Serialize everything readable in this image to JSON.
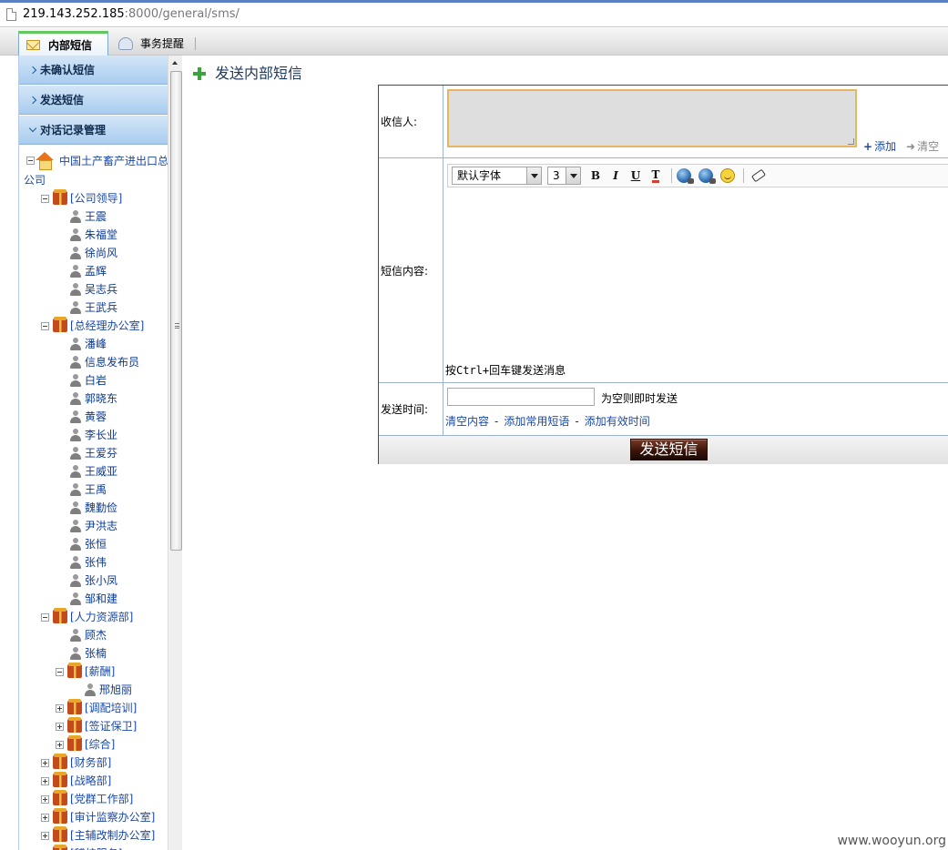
{
  "address_bar": {
    "host": "219.143.252.185",
    "rest": ":8000/general/sms/"
  },
  "tabs": [
    {
      "label": "内部短信",
      "active": true
    },
    {
      "label": "事务提醒",
      "active": false
    }
  ],
  "sidebar": {
    "menu": [
      {
        "label": "未确认短信"
      },
      {
        "label": "发送短信"
      },
      {
        "label": "对话记录管理"
      }
    ],
    "org_root_line1": "中国土产畜产进出口总",
    "org_root_line2": "公司",
    "tree": [
      {
        "type": "dept",
        "label": "[公司领导]",
        "level": 1,
        "expanded": true
      },
      {
        "type": "user",
        "label": "王震",
        "level": 2
      },
      {
        "type": "user",
        "label": "朱福堂",
        "level": 2
      },
      {
        "type": "user",
        "label": "徐尚风",
        "level": 2
      },
      {
        "type": "user",
        "label": "孟辉",
        "level": 2
      },
      {
        "type": "user",
        "label": "吴志兵",
        "level": 2
      },
      {
        "type": "user",
        "label": "王武兵",
        "level": 2
      },
      {
        "type": "dept",
        "label": "[总经理办公室]",
        "level": 1,
        "expanded": true
      },
      {
        "type": "user",
        "label": "潘峰",
        "level": 2
      },
      {
        "type": "user",
        "label": "信息发布员",
        "level": 2
      },
      {
        "type": "user",
        "label": "白岩",
        "level": 2
      },
      {
        "type": "user",
        "label": "郭晓东",
        "level": 2
      },
      {
        "type": "user",
        "label": "黄蓉",
        "level": 2
      },
      {
        "type": "user",
        "label": "李长业",
        "level": 2
      },
      {
        "type": "user",
        "label": "王爱芬",
        "level": 2
      },
      {
        "type": "user",
        "label": "王威亚",
        "level": 2
      },
      {
        "type": "user",
        "label": "王禹",
        "level": 2
      },
      {
        "type": "user",
        "label": "魏勤俭",
        "level": 2
      },
      {
        "type": "user",
        "label": "尹洪志",
        "level": 2
      },
      {
        "type": "user",
        "label": "张恒",
        "level": 2
      },
      {
        "type": "user",
        "label": "张伟",
        "level": 2
      },
      {
        "type": "user",
        "label": "张小凤",
        "level": 2
      },
      {
        "type": "user",
        "label": "邹和建",
        "level": 2
      },
      {
        "type": "dept",
        "label": "[人力资源部]",
        "level": 1,
        "expanded": true
      },
      {
        "type": "user",
        "label": "顾杰",
        "level": 2
      },
      {
        "type": "user",
        "label": "张楠",
        "level": 2
      },
      {
        "type": "dept",
        "label": "[薪酬]",
        "level": 2,
        "expanded": true
      },
      {
        "type": "user",
        "label": "邢旭丽",
        "level": 3
      },
      {
        "type": "dept",
        "label": "[调配培训]",
        "level": 2,
        "expanded": false
      },
      {
        "type": "dept",
        "label": "[签证保卫]",
        "level": 2,
        "expanded": false
      },
      {
        "type": "dept",
        "label": "[综合]",
        "level": 2,
        "expanded": false
      },
      {
        "type": "dept",
        "label": "[财务部]",
        "level": 1,
        "expanded": false
      },
      {
        "type": "dept",
        "label": "[战略部]",
        "level": 1,
        "expanded": false
      },
      {
        "type": "dept",
        "label": "[党群工作部]",
        "level": 1,
        "expanded": false
      },
      {
        "type": "dept",
        "label": "[审计监察办公室]",
        "level": 1,
        "expanded": false
      },
      {
        "type": "dept",
        "label": "[主辅改制办公室]",
        "level": 1,
        "expanded": false
      },
      {
        "type": "dept",
        "label": "[稽核服务]",
        "level": 1,
        "expanded": false
      }
    ]
  },
  "main": {
    "title": "发送内部短信",
    "recipient_label": "收信人:",
    "add_label": "添加",
    "clear_label": "清空",
    "content_label": "短信内容:",
    "font_select": "默认字体",
    "size_select": "3",
    "bold": "B",
    "italic": "I",
    "underline": "U",
    "hint": "按Ctrl+回车键发送消息",
    "time_label": "发送时间:",
    "time_value": "",
    "time_note": "为空则即时发送",
    "link_clear": "清空内容",
    "link_phrase": "添加常用短语",
    "link_valid": "添加有效时间",
    "send_button": "发送短信"
  },
  "watermark": "www.wooyun.org"
}
